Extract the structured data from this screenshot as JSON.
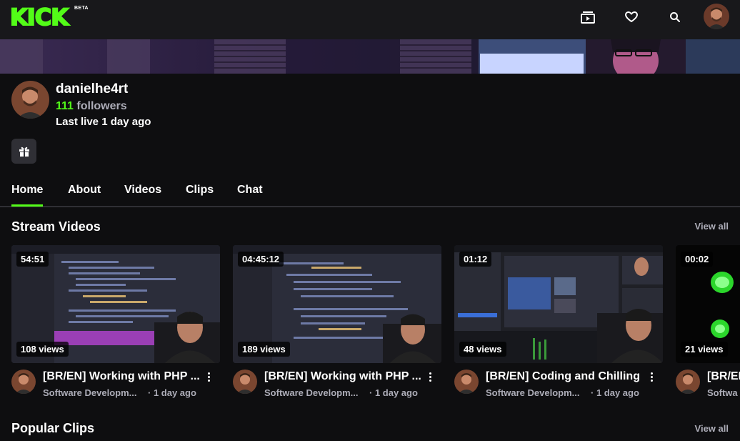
{
  "header": {
    "logo": "KICK",
    "beta": "BETA",
    "icons": [
      "following-icon",
      "heart-icon",
      "search-icon"
    ]
  },
  "profile": {
    "username": "danielhe4rt",
    "followers_count": "111",
    "followers_label": "followers",
    "last_live": "Last live 1 day ago"
  },
  "tabs": [
    "Home",
    "About",
    "Videos",
    "Clips",
    "Chat"
  ],
  "active_tab": "Home",
  "stream_videos": {
    "title": "Stream Videos",
    "view_all": "View all",
    "items": [
      {
        "duration": "54:51",
        "views": "108 views",
        "title": "[BR/EN] Working with PHP ...",
        "category": "Software Developm...",
        "time": "· 1 day ago"
      },
      {
        "duration": "04:45:12",
        "views": "189 views",
        "title": "[BR/EN] Working with PHP ...",
        "category": "Software Developm...",
        "time": "· 1 day ago"
      },
      {
        "duration": "01:12",
        "views": "48 views",
        "title": "[BR/EN] Coding and Chilling",
        "category": "Software Developm...",
        "time": "· 1 day ago"
      },
      {
        "duration": "00:02",
        "views": "21 views",
        "title": "[BR/EN",
        "category": "Softwa",
        "time": ""
      }
    ]
  },
  "popular_clips": {
    "title": "Popular Clips",
    "view_all": "View all"
  },
  "colors": {
    "accent": "#53fc18",
    "bg": "#0e0e10",
    "surface": "#18181b",
    "muted": "#adadb8"
  }
}
